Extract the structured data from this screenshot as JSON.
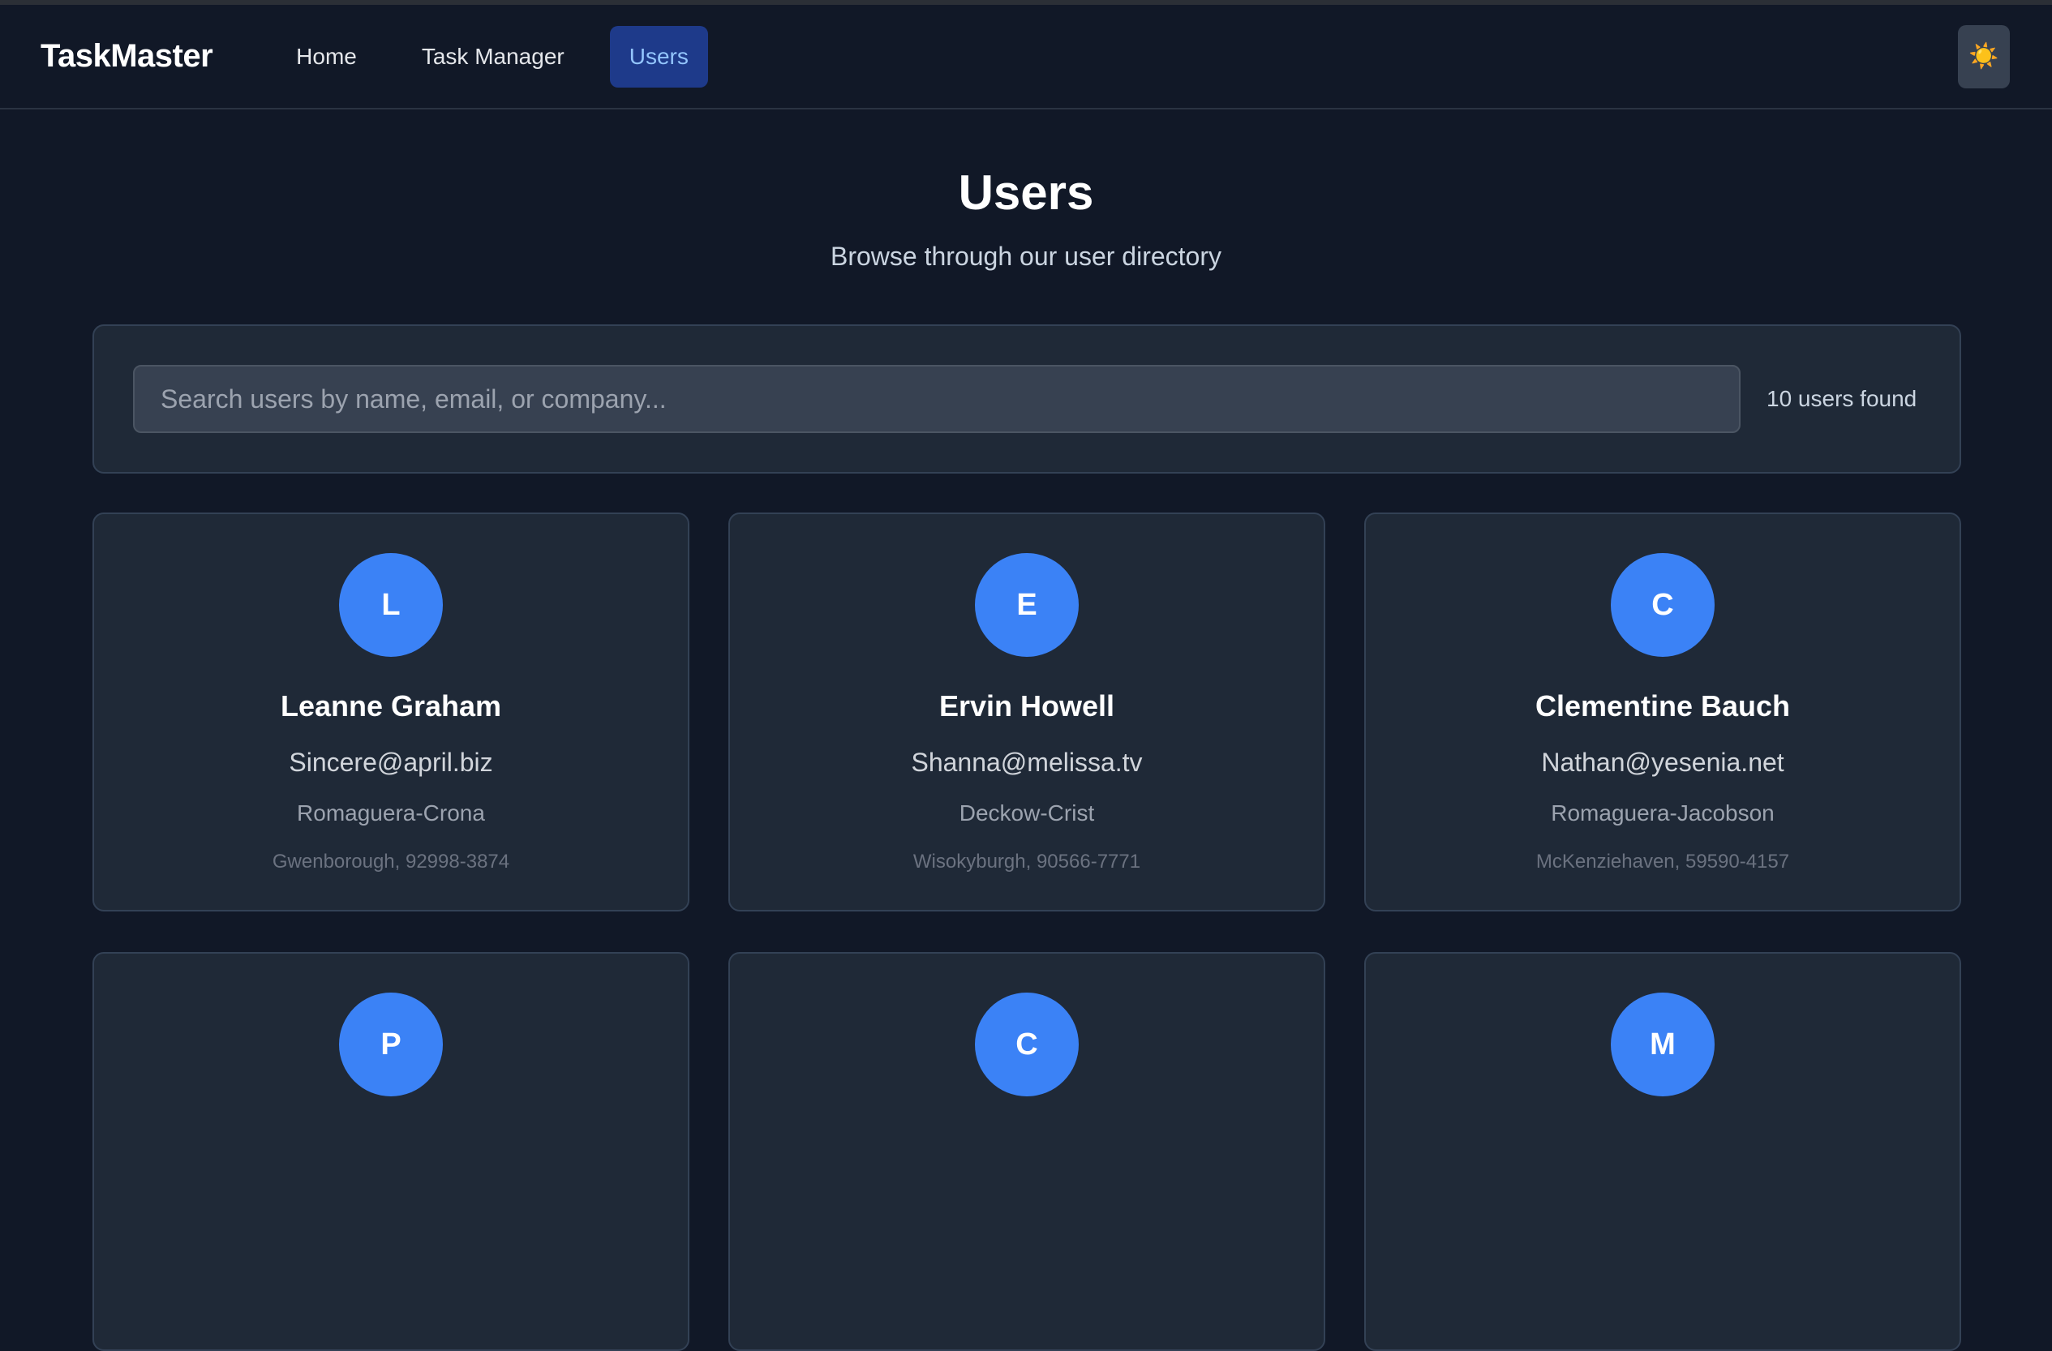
{
  "nav": {
    "brand": "TaskMaster",
    "links": [
      {
        "label": "Home"
      },
      {
        "label": "Task Manager"
      },
      {
        "label": "Users"
      }
    ],
    "theme_icon": "☀️"
  },
  "header": {
    "title": "Users",
    "subtitle": "Browse through our user directory"
  },
  "search": {
    "placeholder": "Search users by name, email, or company...",
    "value": "",
    "result_count": "10 users found"
  },
  "users": [
    {
      "initial": "L",
      "name": "Leanne Graham",
      "email": "Sincere@april.biz",
      "company": "Romaguera-Crona",
      "location": "Gwenborough, 92998-3874"
    },
    {
      "initial": "E",
      "name": "Ervin Howell",
      "email": "Shanna@melissa.tv",
      "company": "Deckow-Crist",
      "location": "Wisokyburgh, 90566-7771"
    },
    {
      "initial": "C",
      "name": "Clementine Bauch",
      "email": "Nathan@yesenia.net",
      "company": "Romaguera-Jacobson",
      "location": "McKenziehaven, 59590-4157"
    },
    {
      "initial": "P",
      "name": "",
      "email": "",
      "company": "",
      "location": ""
    },
    {
      "initial": "C",
      "name": "",
      "email": "",
      "company": "",
      "location": ""
    },
    {
      "initial": "M",
      "name": "",
      "email": "",
      "company": "",
      "location": ""
    }
  ],
  "colors": {
    "background": "#111827",
    "card": "#1f2937",
    "accent": "#3b82f6",
    "active_nav": "#1e3a8a"
  }
}
